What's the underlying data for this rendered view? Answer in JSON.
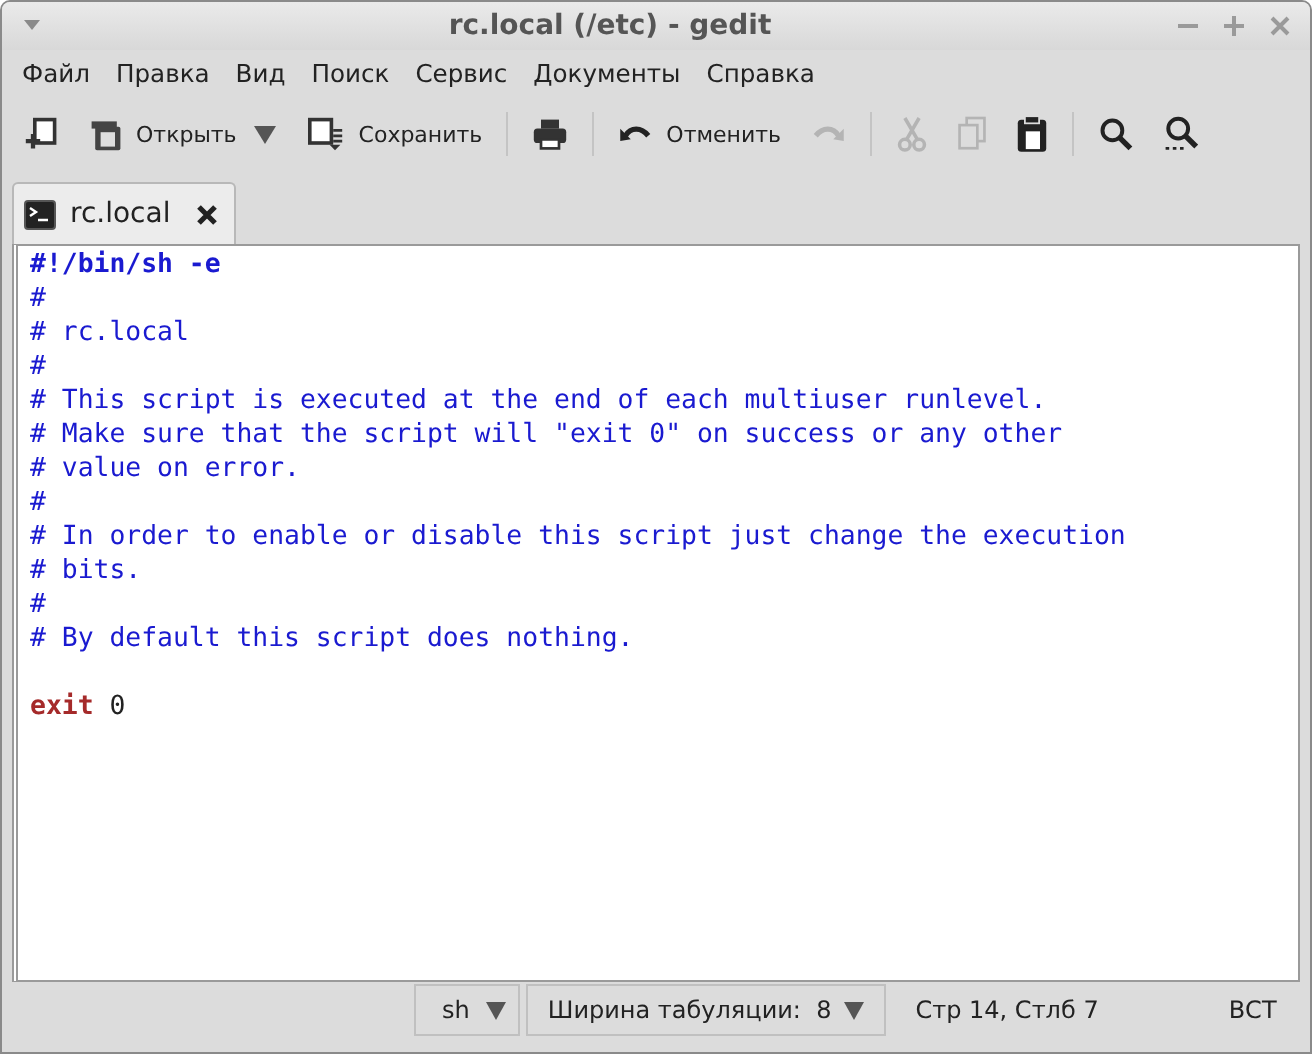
{
  "window": {
    "title": "rc.local (/etc) - gedit"
  },
  "menu": [
    {
      "label": "Файл"
    },
    {
      "label": "Правка"
    },
    {
      "label": "Вид"
    },
    {
      "label": "Поиск"
    },
    {
      "label": "Сервис"
    },
    {
      "label": "Документы"
    },
    {
      "label": "Справка"
    }
  ],
  "toolbar": {
    "open": {
      "label": "Открыть"
    },
    "save": {
      "label": "Сохранить"
    },
    "undo": {
      "label": "Отменить",
      "disabled": false
    },
    "redo": {
      "disabled": true
    },
    "cut": {
      "disabled": true
    },
    "copy": {
      "disabled": true
    },
    "paste": {
      "disabled": false
    }
  },
  "tabs": [
    {
      "label": "rc.local",
      "selected": true
    }
  ],
  "code": [
    {
      "tokens": [
        {
          "kind": "shebang",
          "text": "#!/bin/sh -e"
        }
      ]
    },
    {
      "tokens": [
        {
          "kind": "comment",
          "text": "#"
        }
      ]
    },
    {
      "tokens": [
        {
          "kind": "comment",
          "text": "# rc.local"
        }
      ]
    },
    {
      "tokens": [
        {
          "kind": "comment",
          "text": "#"
        }
      ]
    },
    {
      "tokens": [
        {
          "kind": "comment",
          "text": "# This script is executed at the end of each multiuser runlevel."
        }
      ]
    },
    {
      "tokens": [
        {
          "kind": "comment",
          "text": "# Make sure that the script will \"exit 0\" on success or any other"
        }
      ]
    },
    {
      "tokens": [
        {
          "kind": "comment",
          "text": "# value on error."
        }
      ]
    },
    {
      "tokens": [
        {
          "kind": "comment",
          "text": "#"
        }
      ]
    },
    {
      "tokens": [
        {
          "kind": "comment",
          "text": "# In order to enable or disable this script just change the execution"
        }
      ]
    },
    {
      "tokens": [
        {
          "kind": "comment",
          "text": "# bits."
        }
      ]
    },
    {
      "tokens": [
        {
          "kind": "comment",
          "text": "#"
        }
      ]
    },
    {
      "tokens": [
        {
          "kind": "comment",
          "text": "# By default this script does nothing."
        }
      ]
    },
    {
      "kind": "blank"
    },
    {
      "tokens": [
        {
          "kind": "keyword",
          "text": "exit"
        },
        {
          "kind": "number",
          "text": "0"
        }
      ]
    }
  ],
  "status_bar": {
    "language": "sh",
    "tab_width": "Ширина табуляции:  8",
    "position": "Стр 14, Стлб 7",
    "mode": "ВСТ"
  }
}
